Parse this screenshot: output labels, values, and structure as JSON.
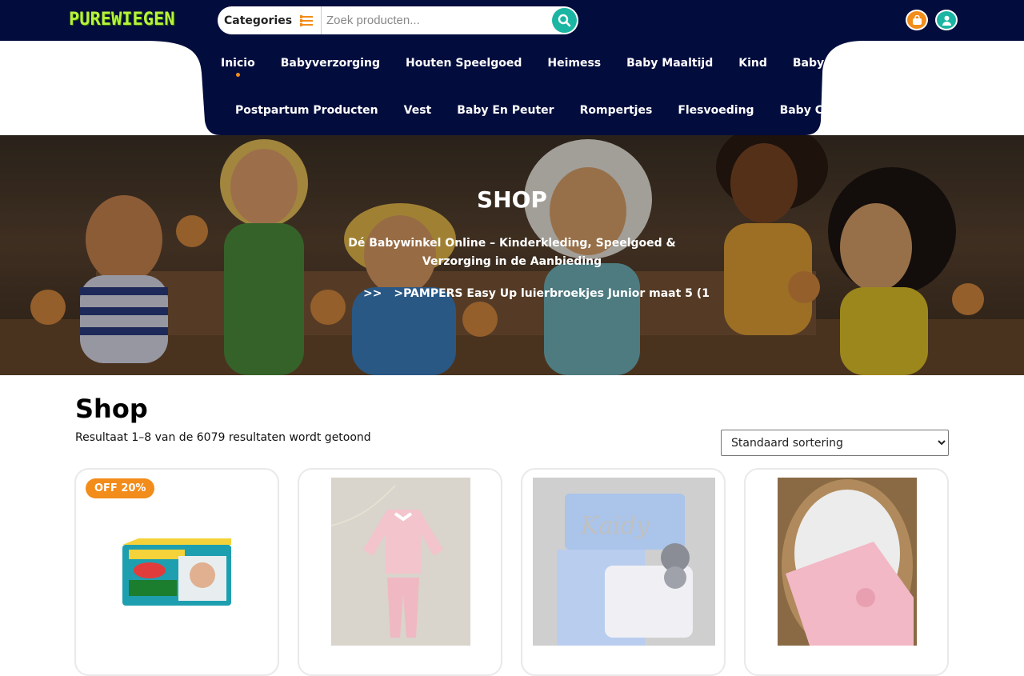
{
  "header": {
    "logo_text": "PUREWIEGEN",
    "categories_label": "Categories",
    "search_placeholder": "Zoek producten...",
    "icons": [
      "list-icon",
      "search-icon",
      "shopping-bag-icon",
      "user-icon"
    ],
    "colors": {
      "bar": "#030d3d",
      "logo": "#b8f23a",
      "accent_orange": "#f28c1a",
      "accent_teal": "#1bb5a3"
    }
  },
  "nav": {
    "row1": [
      "Inicio",
      "Babyverzorging",
      "Houten Speelgoed",
      "Heimess",
      "Baby Maaltijd",
      "Kind",
      "Babydoekjes"
    ],
    "row2": [
      "Postpartum Producten",
      "Vest",
      "Baby En Peuter",
      "Rompertjes",
      "Flesvoeding",
      "Baby Creme"
    ],
    "active": "Inicio"
  },
  "hero": {
    "title": "SHOP",
    "subtitle": "Dé Babywinkel Online – Kinderkleding, Speelgoed & Verzorging in de Aanbieding",
    "breadcrumb_sep": ">>",
    "breadcrumb_text": ">PAMPERS Easy Up luierbroekjes Junior maat 5 (1"
  },
  "shop": {
    "title": "Shop",
    "result_count": "Resultaat 1–8 van de 6079 resultaten wordt getoond",
    "sort_selected": "Standaard sortering",
    "products": [
      {
        "badge": "OFF 20%",
        "image": "pampers-box"
      },
      {
        "badge": "",
        "image": "pink-knit-set"
      },
      {
        "badge": "",
        "image": "blue-name-blanket"
      },
      {
        "badge": "",
        "image": "pink-blanket-basket"
      }
    ]
  }
}
